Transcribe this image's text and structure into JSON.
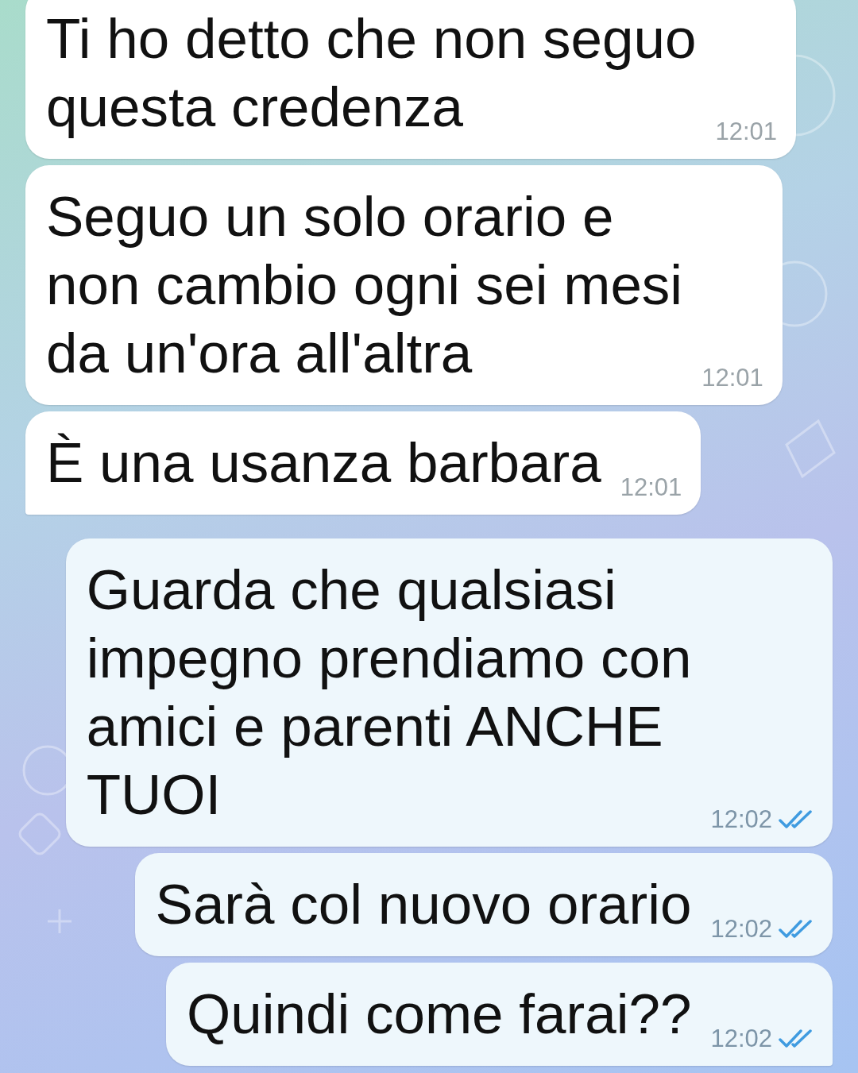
{
  "messages": [
    {
      "kind": "incoming",
      "text": "Ti ho detto che non seguo\nquesta credenza",
      "time": "12:01",
      "tail": false
    },
    {
      "kind": "incoming",
      "text": "Seguo un solo orario e\nnon cambio ogni sei mesi\nda un'ora all'altra",
      "time": "12:01",
      "tail": false
    },
    {
      "kind": "incoming",
      "text": "È una usanza barbara",
      "time": "12:01",
      "tail": true
    },
    {
      "kind": "outgoing",
      "text": "Guarda che qualsiasi\nimpegno prendiamo con\namici e parenti ANCHE\nTUOI",
      "time": "12:02",
      "read": true,
      "tail": false
    },
    {
      "kind": "outgoing",
      "text": "Sarà col nuovo orario",
      "time": "12:02",
      "read": true,
      "tail": false
    },
    {
      "kind": "outgoing",
      "text": "Quindi come farai??",
      "time": "12:02",
      "read": true,
      "tail": true
    }
  ]
}
